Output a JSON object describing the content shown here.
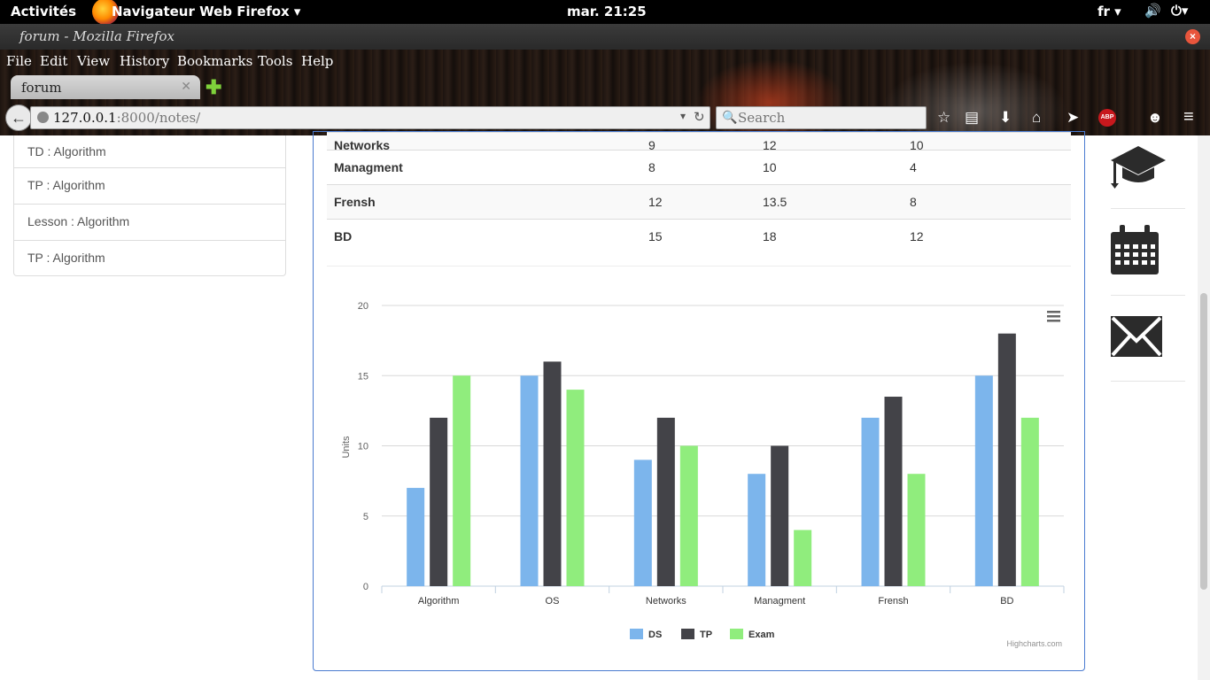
{
  "os": {
    "activities": "Activités",
    "app_name": "Navigateur Web Firefox ▾",
    "clock": "mar. 21:25",
    "lang": "fr ▾"
  },
  "window": {
    "title": "forum - Mozilla Firefox"
  },
  "menu": [
    "File",
    "Edit",
    "View",
    "History",
    "Bookmarks",
    "Tools",
    "Help"
  ],
  "tab": {
    "label": "forum"
  },
  "url": {
    "host": "127.0.0.1",
    "rest": ":8000/notes/"
  },
  "search": {
    "placeholder": "Search"
  },
  "sidebar": {
    "items": [
      "TD : Algorithm",
      "TP : Algorithm",
      "Lesson : Algorithm",
      "TP : Algorithm"
    ]
  },
  "table": {
    "rows": [
      {
        "subject": "Networks",
        "ds": "9",
        "tp": "12",
        "exam": "10"
      },
      {
        "subject": "Managment",
        "ds": "8",
        "tp": "10",
        "exam": "4"
      },
      {
        "subject": "Frensh",
        "ds": "12",
        "tp": "13.5",
        "exam": "8"
      },
      {
        "subject": "BD",
        "ds": "15",
        "tp": "18",
        "exam": "12"
      }
    ]
  },
  "chart_data": {
    "type": "bar",
    "categories": [
      "Algorithm",
      "OS",
      "Networks",
      "Managment",
      "Frensh",
      "BD"
    ],
    "series": [
      {
        "name": "DS",
        "values": [
          7,
          15,
          9,
          8,
          12,
          15
        ],
        "color": "#7cb5ec"
      },
      {
        "name": "TP",
        "values": [
          12,
          16,
          12,
          10,
          13.5,
          18
        ],
        "color": "#434348"
      },
      {
        "name": "Exam",
        "values": [
          15,
          14,
          10,
          4,
          8,
          12
        ],
        "color": "#90ed7d"
      }
    ],
    "ylabel": "Units",
    "ylim": [
      0,
      20
    ],
    "yticks": [
      0,
      5,
      10,
      15,
      20
    ],
    "legend": "bottom-center",
    "credit": "Highcharts.com"
  }
}
